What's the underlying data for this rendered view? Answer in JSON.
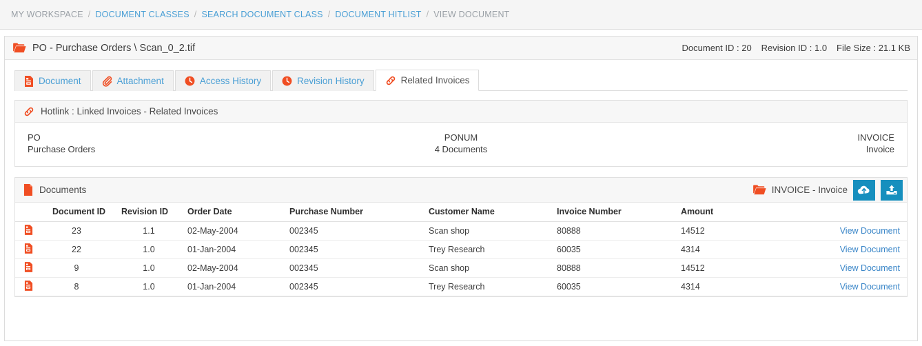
{
  "breadcrumb": {
    "items": [
      {
        "label": "MY WORKSPACE",
        "state": "muted"
      },
      {
        "label": "DOCUMENT CLASSES",
        "state": "link"
      },
      {
        "label": "SEARCH DOCUMENT CLASS",
        "state": "link"
      },
      {
        "label": "DOCUMENT HITLIST",
        "state": "link"
      },
      {
        "label": "VIEW DOCUMENT",
        "state": "current"
      }
    ],
    "separator": "/"
  },
  "document_header": {
    "folder_icon": "folder-open-icon",
    "title": "PO - Purchase Orders \\ Scan_0_2.tif",
    "document_id": "Document ID : 20",
    "revision_id": "Revision ID : 1.0",
    "file_size": "File Size : 21.1 KB"
  },
  "tabs": [
    {
      "label": "Document",
      "icon": "document-icon",
      "active": false
    },
    {
      "label": "Attachment",
      "icon": "paperclip-icon",
      "active": false
    },
    {
      "label": "Access History",
      "icon": "clock-icon",
      "active": false
    },
    {
      "label": "Revision History",
      "icon": "clock-icon",
      "active": false
    },
    {
      "label": "Related Invoices",
      "icon": "link-icon",
      "active": true
    }
  ],
  "hotlink_panel": {
    "icon": "link-icon",
    "title": "Hotlink : Linked Invoices - Related Invoices",
    "columns": [
      {
        "key": "PO",
        "value": "Purchase Orders",
        "align": "left"
      },
      {
        "key": "PONUM",
        "value": "4 Documents",
        "align": "center"
      },
      {
        "key": "INVOICE",
        "value": "Invoice",
        "align": "right"
      }
    ]
  },
  "documents_panel": {
    "icon": "document-icon",
    "title": "Documents",
    "target_icon": "folder-open-icon",
    "target_label": "INVOICE - Invoice",
    "buttons": [
      {
        "name": "cloud-upload-button",
        "icon": "cloud-upload-icon"
      },
      {
        "name": "upload-button",
        "icon": "upload-tray-icon"
      }
    ],
    "table": {
      "headers": [
        "",
        "Document ID",
        "Revision ID",
        "Order Date",
        "Purchase Number",
        "Customer Name",
        "Invoice Number",
        "Amount",
        ""
      ],
      "rows": [
        {
          "icon": "document-icon",
          "document_id": "23",
          "revision_id": "1.1",
          "order_date": "02-May-2004",
          "purchase_number": "002345",
          "customer_name": "Scan shop",
          "invoice_number": "80888",
          "amount": "14512",
          "action": "View Document"
        },
        {
          "icon": "document-icon",
          "document_id": "22",
          "revision_id": "1.0",
          "order_date": "01-Jan-2004",
          "purchase_number": "002345",
          "customer_name": "Trey Research",
          "invoice_number": "60035",
          "amount": "4314",
          "action": "View Document"
        },
        {
          "icon": "document-icon",
          "document_id": "9",
          "revision_id": "1.0",
          "order_date": "02-May-2004",
          "purchase_number": "002345",
          "customer_name": "Scan shop",
          "invoice_number": "80888",
          "amount": "14512",
          "action": "View Document"
        },
        {
          "icon": "document-icon",
          "document_id": "8",
          "revision_id": "1.0",
          "order_date": "01-Jan-2004",
          "purchase_number": "002345",
          "customer_name": "Trey Research",
          "invoice_number": "60035",
          "amount": "4314",
          "action": "View Document"
        }
      ]
    }
  },
  "colors": {
    "accent_red": "#f04e23",
    "link_blue": "#4a9fd5",
    "button_blue": "#168fbe",
    "header_grey": "#f5f5f5"
  }
}
